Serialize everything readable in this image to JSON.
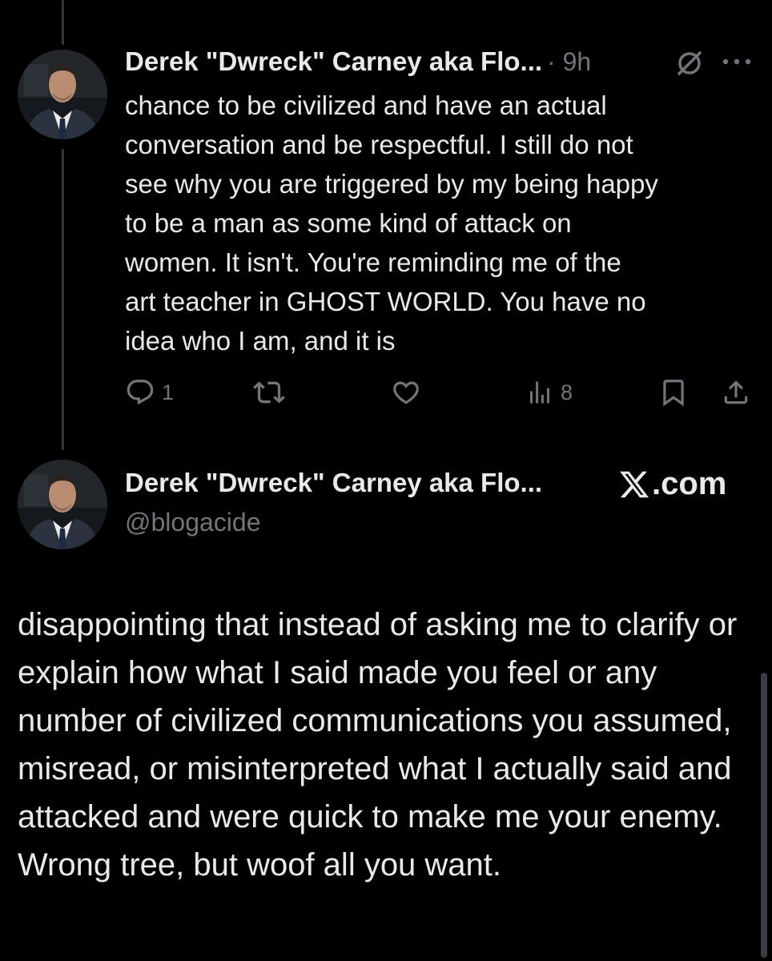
{
  "reply_tweet": {
    "author_name": "Derek \"Dwreck\" Carney aka Flo...",
    "time": "· 9h",
    "text": "chance to be civilized and have an actual\nconversation and be respectful. I still do not\nsee why you are triggered by my being happy\nto be a man as some kind of attack on\nwomen. It isn't. You're reminding me of the\nart teacher in GHOST WORLD. You have no\nidea who I am, and it is",
    "stats": {
      "replies": "1",
      "views": "8"
    },
    "icons": [
      "grok-icon",
      "more-icon",
      "reply-icon",
      "retweet-icon",
      "like-icon",
      "views-icon",
      "bookmark-icon",
      "share-icon"
    ]
  },
  "quote_card": {
    "author_name": "Derek \"Dwreck\" Carney aka Flo...",
    "handle": "@blogacide",
    "brand": ".com",
    "brand_icon": "x-logo-icon",
    "text": "disappointing that instead of asking me to clarify or explain how what I said made you feel or any number of civilized communications you assumed, misread, or misinterpreted what I actually said and attacked and were quick to make me your enemy. Wrong tree, but woof all you want."
  },
  "colors": {
    "background": "#000000",
    "text": "#e7e9ea",
    "secondary": "#71767b",
    "thread_line": "#333639"
  }
}
